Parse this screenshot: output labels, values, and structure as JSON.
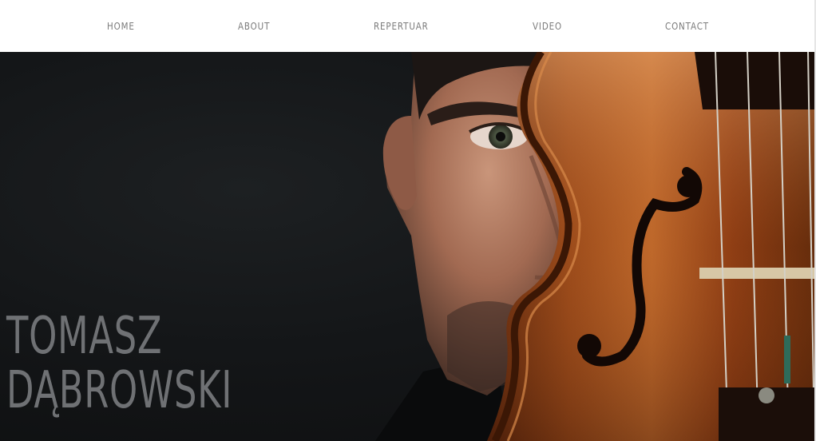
{
  "nav": {
    "items": [
      {
        "label": "HOME"
      },
      {
        "label": "ABOUT"
      },
      {
        "label": "REPERTUAR"
      },
      {
        "label": "VIDEO"
      },
      {
        "label": "CONTACT"
      }
    ]
  },
  "hero": {
    "first_name": "TOMASZ",
    "last_name": "DĄBROWSKI",
    "image": "violinist-portrait-with-violin"
  },
  "colors": {
    "nav_text": "#7a7a7a",
    "hero_background": "#121314",
    "name_text": "#6f7174",
    "violin_wood": "#8a3f14"
  }
}
